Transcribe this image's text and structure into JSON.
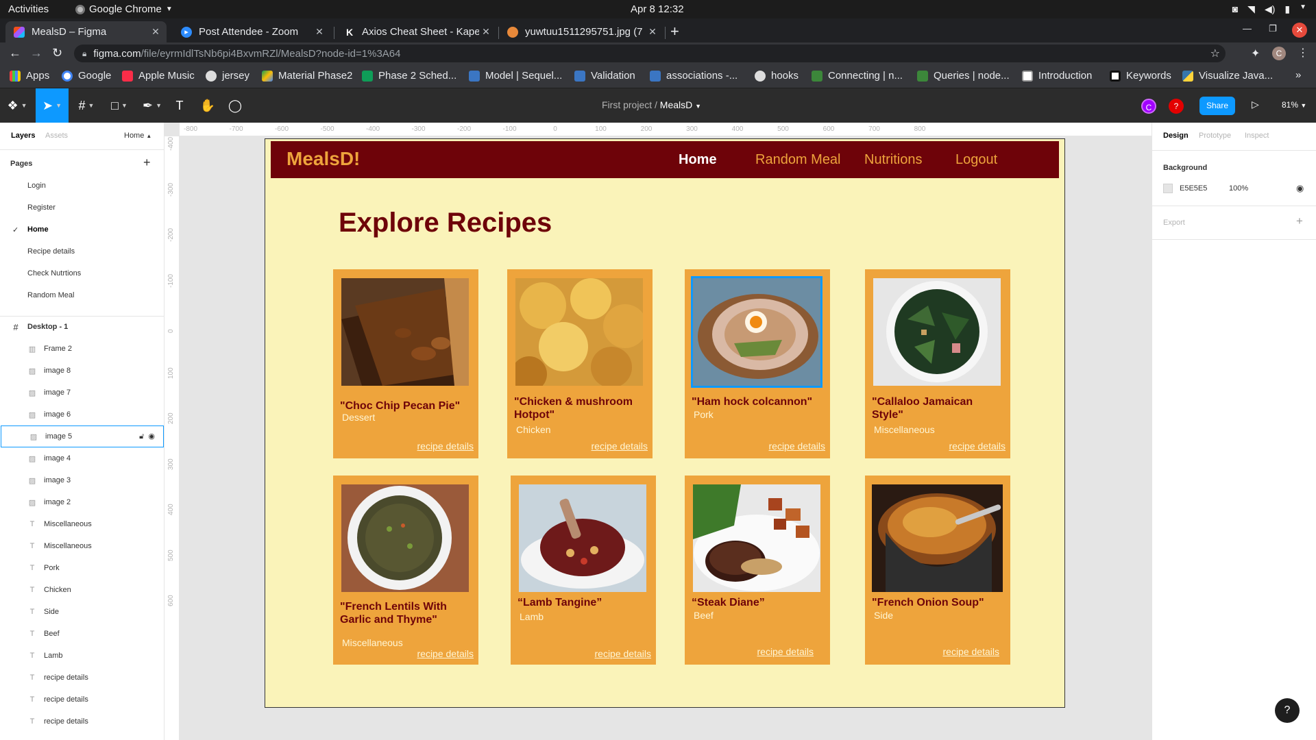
{
  "system": {
    "activities": "Activities",
    "app_name": "Google Chrome",
    "clock": "Apr 8  12:32"
  },
  "browser": {
    "tabs": [
      {
        "title": "MealsD – Figma",
        "icon": "figma-icon"
      },
      {
        "title": "Post Attendee - Zoom",
        "icon": "zoom-icon"
      },
      {
        "title": "Axios Cheat Sheet - Kapeli",
        "icon": "kapeli-icon"
      },
      {
        "title": "yuwtuu1511295751.jpg (7",
        "icon": "image-icon"
      }
    ],
    "url_host": "figma.com",
    "url_path": "/file/eyrmIdlTsNb6pi4BxvmRZl/MealsD?node-id=1%3A64",
    "profile_initial": "C",
    "bookmarks": [
      "Apps",
      "Google",
      "Apple Music",
      "jersey",
      "Material Phase2",
      "Phase 2 Sched...",
      "Model | Sequel...",
      "Validation",
      "associations -...",
      "hooks",
      "Connecting | n...",
      "Queries | node...",
      "Introduction",
      "Keywords",
      "Visualize Java..."
    ]
  },
  "figma": {
    "file_project": "First project",
    "file_separator": "/",
    "file_name": "MealsD",
    "collab_initials": [
      "C",
      "?"
    ],
    "share_label": "Share",
    "zoom": "81%",
    "left_tabs": {
      "layers": "Layers",
      "assets": "Assets",
      "page": "Home"
    },
    "pages_title": "Pages",
    "pages": [
      "Login",
      "Register",
      "Home",
      "Recipe details",
      "Check Nutrtions",
      "Random Meal"
    ],
    "current_page": "Home",
    "frame_name": "Desktop - 1",
    "layers": [
      {
        "name": "Frame 2",
        "type": "frame"
      },
      {
        "name": "image 8",
        "type": "image"
      },
      {
        "name": "image 7",
        "type": "image"
      },
      {
        "name": "image 6",
        "type": "image"
      },
      {
        "name": "image 5",
        "type": "image"
      },
      {
        "name": "image 4",
        "type": "image"
      },
      {
        "name": "image 3",
        "type": "image"
      },
      {
        "name": "image 2",
        "type": "image"
      },
      {
        "name": "Miscellaneous",
        "type": "text"
      },
      {
        "name": "Miscellaneous",
        "type": "text"
      },
      {
        "name": "Pork",
        "type": "text"
      },
      {
        "name": "Chicken",
        "type": "text"
      },
      {
        "name": "Side",
        "type": "text"
      },
      {
        "name": "Beef",
        "type": "text"
      },
      {
        "name": "Lamb",
        "type": "text"
      },
      {
        "name": "recipe details",
        "type": "text"
      },
      {
        "name": "recipe details",
        "type": "text"
      },
      {
        "name": "recipe details",
        "type": "text"
      }
    ],
    "selected_layer": "image 5",
    "ruler_x": [
      "-800",
      "-700",
      "-600",
      "-500",
      "-400",
      "-300",
      "-200",
      "-100",
      "0",
      "100",
      "200",
      "300",
      "400",
      "500",
      "600",
      "700",
      "800"
    ],
    "ruler_y": [
      "-400",
      "-300",
      "-200",
      "-100",
      "0",
      "100",
      "200",
      "300",
      "400",
      "500",
      "600"
    ],
    "right_tabs": {
      "design": "Design",
      "prototype": "Prototype",
      "inspect": "Inspect"
    },
    "background_title": "Background",
    "background_hex": "E5E5E5",
    "background_opacity": "100%",
    "export_title": "Export",
    "help": "?"
  },
  "site": {
    "logo": "MealsD!",
    "nav": [
      "Home",
      "Random Meal",
      "Nutritions",
      "Logout"
    ],
    "heading": "Explore Recipes",
    "colors": {
      "nav_bg": "#6e0309",
      "accent": "#eea43c",
      "page_bg": "#faf3b9"
    },
    "cards": [
      {
        "name": "\"Choc Chip Pecan Pie\"",
        "category": "Dessert",
        "link": "recipe details",
        "image": "pecan-pie"
      },
      {
        "name": "\"Chicken & mushroom Hotpot\"",
        "category": "Chicken",
        "link": "recipe details",
        "image": "hotpot"
      },
      {
        "name": "\"Ham hock colcannon\"",
        "category": "Pork",
        "link": "recipe details",
        "image": "colcannon"
      },
      {
        "name": "\"Callaloo Jamaican Style\"",
        "category": "Miscellaneous",
        "link": "recipe details",
        "image": "callaloo"
      },
      {
        "name": "\"French Lentils With Garlic and Thyme\"",
        "category": "Miscellaneous",
        "link": "recipe details",
        "image": "lentils"
      },
      {
        "name": "“Lamb Tangine”",
        "category": "Lamb",
        "link": "recipe details",
        "image": "lamb-tagine"
      },
      {
        "name": "“Steak Diane”",
        "category": "Beef",
        "link": "recipe details",
        "image": "steak"
      },
      {
        "name": "\"French Onion Soup\"",
        "category": "Side",
        "link": "recipe details",
        "image": "onion-soup"
      }
    ]
  }
}
